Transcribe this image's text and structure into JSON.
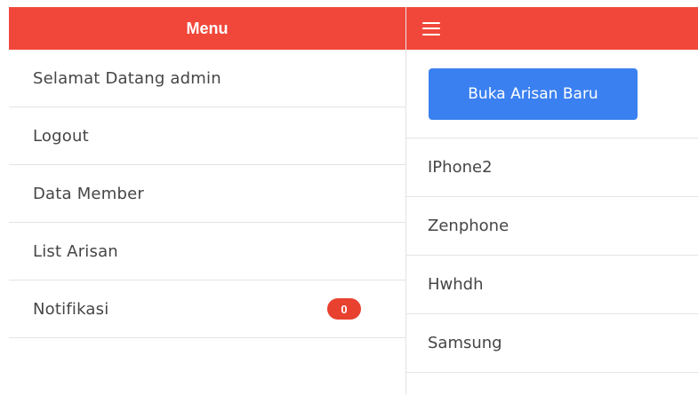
{
  "sidebar": {
    "title": "Menu",
    "items": [
      {
        "label": "Selamat Datang admin"
      },
      {
        "label": "Logout"
      },
      {
        "label": "Data Member"
      },
      {
        "label": "List Arisan"
      },
      {
        "label": "Notifikasi",
        "badge": "0"
      }
    ]
  },
  "topbar": {
    "menu_icon": "hamburger-icon"
  },
  "main": {
    "new_button_label": "Buka Arisan Baru",
    "list": [
      {
        "label": "IPhone2"
      },
      {
        "label": "Zenphone"
      },
      {
        "label": "Hwhdh"
      },
      {
        "label": "Samsung"
      }
    ]
  },
  "colors": {
    "header": "#f1473b",
    "primary": "#3a80f0",
    "badge": "#e8412f"
  }
}
